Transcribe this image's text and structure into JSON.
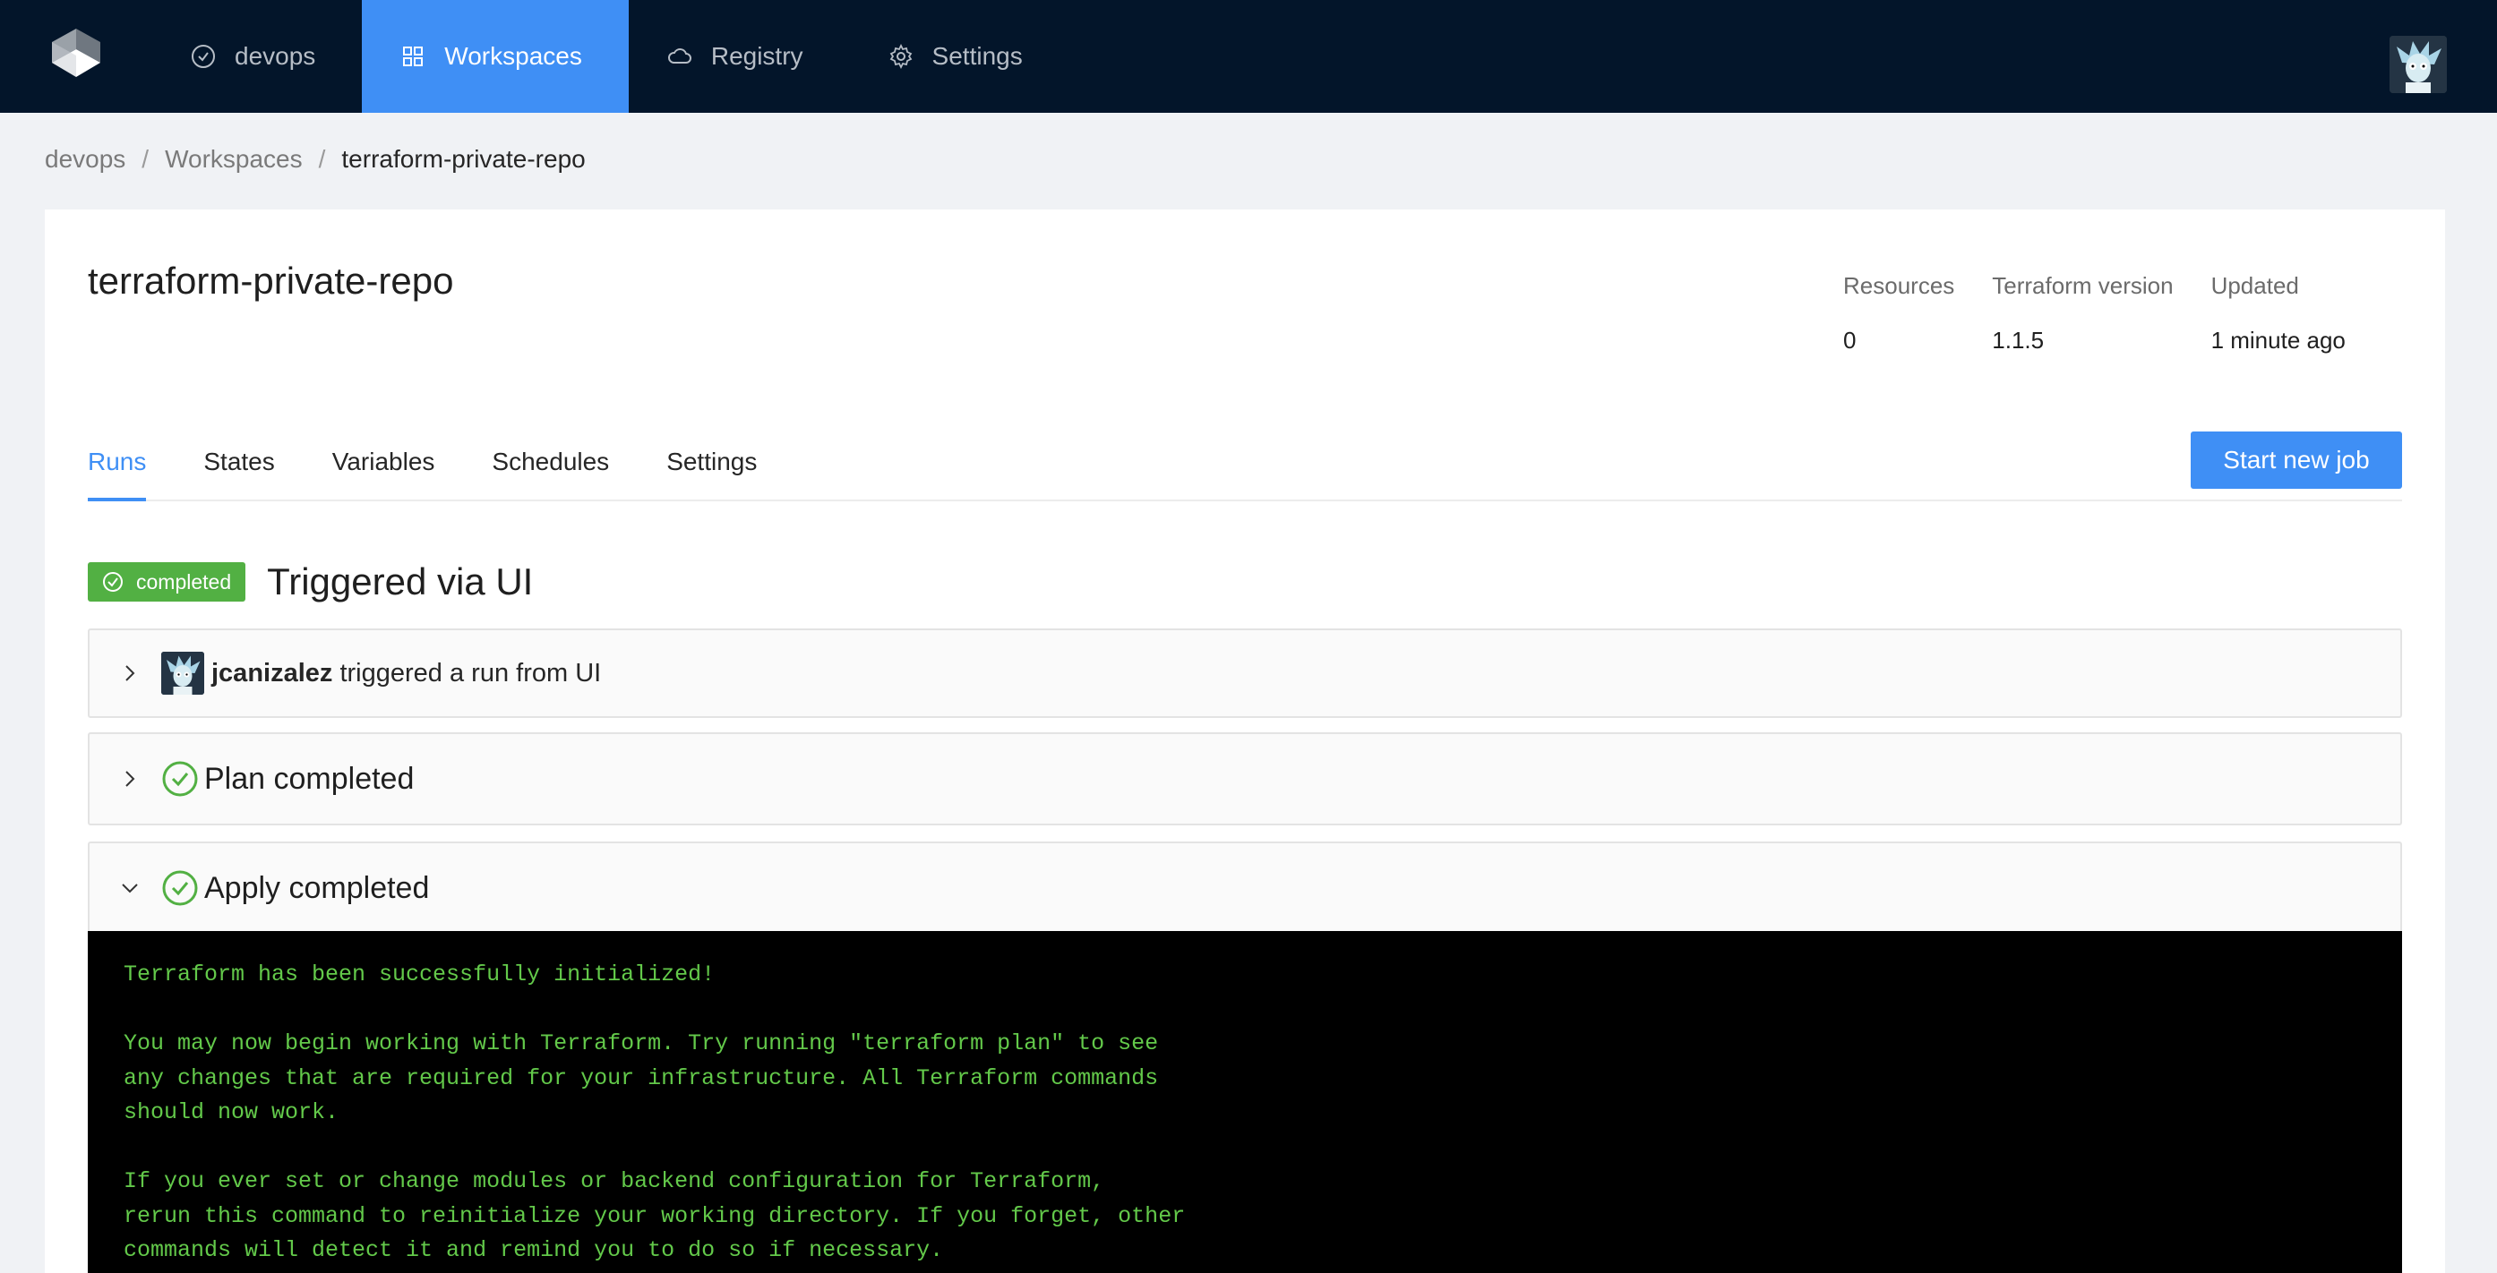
{
  "nav": {
    "org": "devops",
    "workspaces": "Workspaces",
    "registry": "Registry",
    "settings": "Settings"
  },
  "breadcrumb": {
    "org": "devops",
    "sep": "/",
    "workspaces": "Workspaces",
    "current": "terraform-private-repo"
  },
  "workspace": {
    "title": "terraform-private-repo",
    "stats": [
      {
        "label": "Resources",
        "value": "0"
      },
      {
        "label": "Terraform version",
        "value": "1.1.5"
      },
      {
        "label": "Updated",
        "value": "1 minute ago"
      }
    ]
  },
  "tabs": [
    "Runs",
    "States",
    "Variables",
    "Schedules",
    "Settings"
  ],
  "start_button": "Start new job",
  "run": {
    "status": "completed",
    "title": "Triggered via UI",
    "user": "jcanizalez",
    "trigger_text": " triggered a run from UI",
    "plan": "Plan completed",
    "apply": "Apply completed"
  },
  "terminal_lines": [
    "Terraform has been successfully initialized!",
    "",
    "You may now begin working with Terraform. Try running \"terraform plan\" to see",
    "any changes that are required for your infrastructure. All Terraform commands",
    "should now work.",
    "",
    "If you ever set or change modules or backend configuration for Terraform,",
    "rerun this command to reinitialize your working directory. If you forget, other",
    "commands will detect it and remind you to do so if necessary."
  ],
  "colors": {
    "nav_bg": "#03152a",
    "accent": "#3f8ff5",
    "success": "#52b043",
    "terminal_text": "#63c94a"
  }
}
